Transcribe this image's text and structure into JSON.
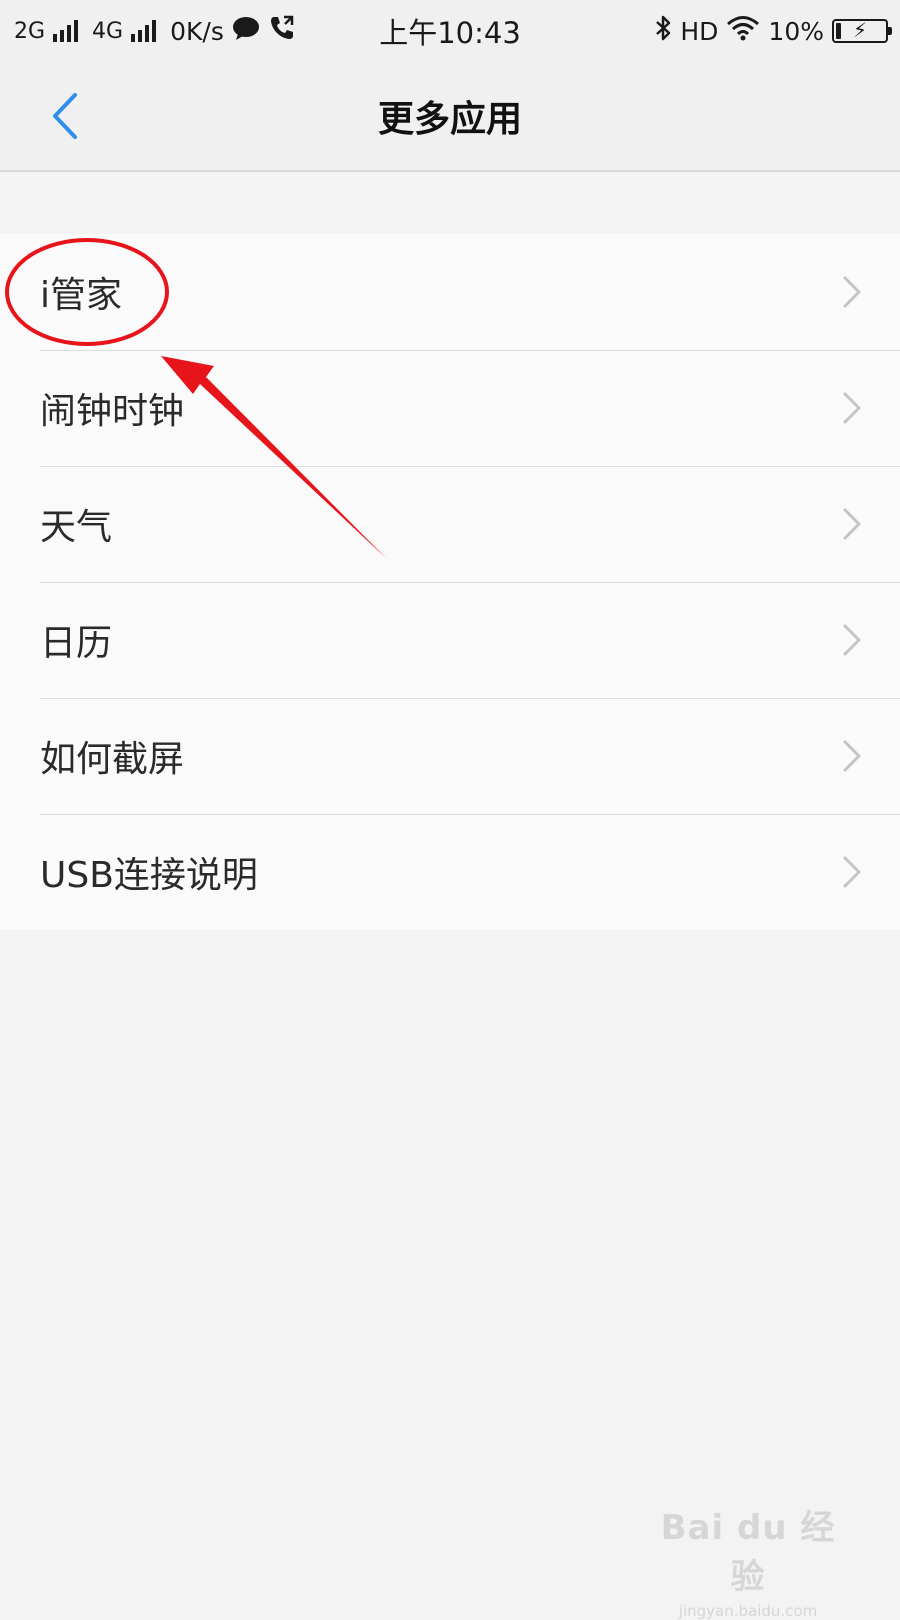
{
  "status_bar": {
    "sim1": "2G",
    "sim2": "4G",
    "net_speed": "0K/s",
    "time": "上午10:43",
    "hd": "HD",
    "battery_percent_text": "10%",
    "battery_level": 0.1,
    "icons": [
      "signal-icon",
      "message-icon",
      "phone-call-icon",
      "bluetooth-icon",
      "wifi-icon",
      "battery-charging-icon"
    ]
  },
  "header": {
    "title": "更多应用",
    "back_icon": "chevron-left-icon",
    "accent_color": "#2f8fe6"
  },
  "list": {
    "items": [
      {
        "label": "i管家"
      },
      {
        "label": "闹钟时钟"
      },
      {
        "label": "天气"
      },
      {
        "label": "日历"
      },
      {
        "label": "如何截屏"
      },
      {
        "label": "USB连接说明"
      }
    ],
    "chevron_icon": "chevron-right-icon"
  },
  "annotation": {
    "color": "#e8141c",
    "shapes": [
      "circle-highlight",
      "arrow"
    ]
  },
  "watermark": {
    "logo": "Bai du 经验",
    "url": "jingyan.baidu.com"
  }
}
